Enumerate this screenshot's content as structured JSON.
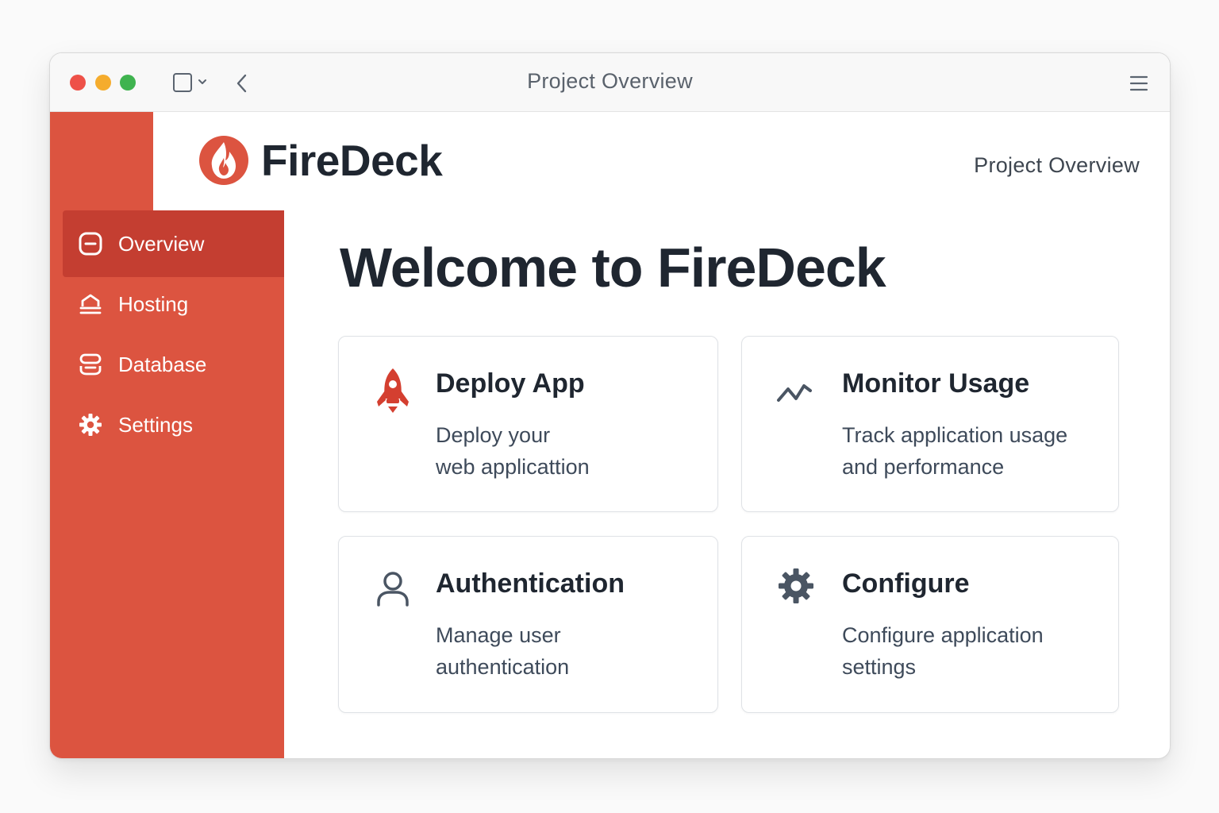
{
  "window": {
    "title": "Project Overview",
    "traffic_lights": [
      "#ee5148",
      "#f5ac2d",
      "#3fb34f"
    ]
  },
  "brand": {
    "name": "FireDeck",
    "accent": "#dc5440",
    "logo_icon": "flame-icon"
  },
  "header": {
    "right_title": "Project Overview"
  },
  "sidebar": {
    "items": [
      {
        "label": "Overview",
        "icon": "overview-icon",
        "active": true
      },
      {
        "label": "Hosting",
        "icon": "hosting-icon",
        "active": false
      },
      {
        "label": "Database",
        "icon": "database-icon",
        "active": false
      },
      {
        "label": "Settings",
        "icon": "gear-icon",
        "active": false
      }
    ]
  },
  "main": {
    "heading": "Welcome to FireDeck",
    "cards": [
      {
        "title": "Deploy App",
        "desc_line1": "Deploy your",
        "desc_line2": "web applicattion",
        "icon": "rocket-icon"
      },
      {
        "title": "Monitor Usage",
        "desc_line1": "Track application usage",
        "desc_line2": "and performance",
        "icon": "activity-icon"
      },
      {
        "title": "Authentication",
        "desc_line1": "Manage user",
        "desc_line2": "authentication",
        "icon": "user-icon"
      },
      {
        "title": "Configure",
        "desc_line1": "Configure application",
        "desc_line2": "settings",
        "icon": "gear-icon"
      }
    ]
  }
}
